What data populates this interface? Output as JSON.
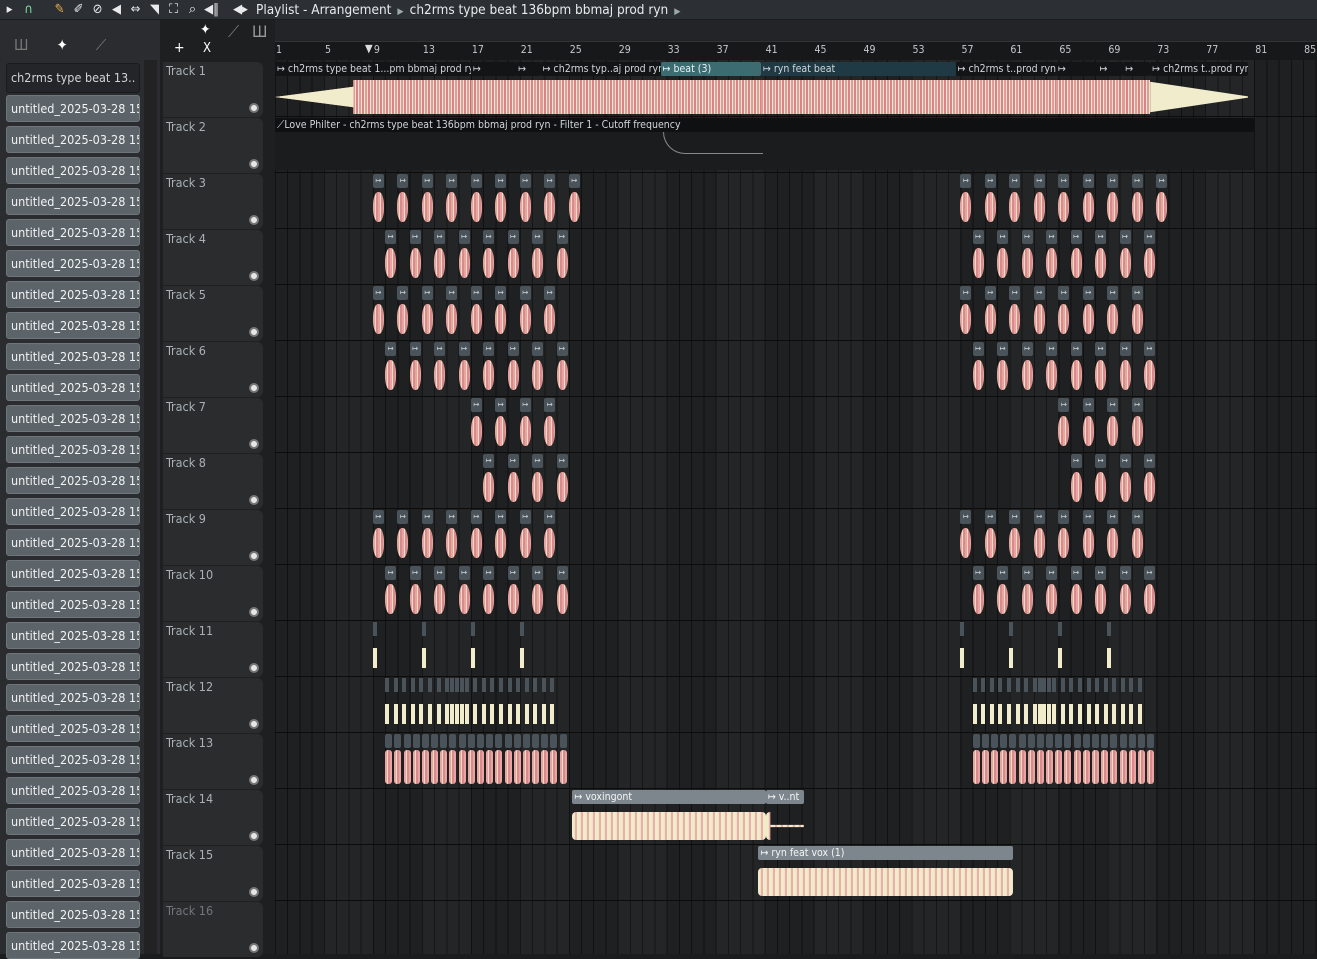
{
  "toolbar": {
    "icons": [
      "play-arrow-icon",
      "magnet-icon",
      "pencil-icon",
      "paint-brush-icon",
      "delete-icon",
      "mute-icon",
      "slip-icon",
      "slice-icon",
      "select-icon",
      "zoom-icon",
      "playback-icon"
    ],
    "title_prefix": "Playlist - Arrangement",
    "project": "ch2rms type beat 136bpm bbmaj prod ryn"
  },
  "left_panel": {
    "header_item": "ch2rms type beat 13..",
    "items": [
      "untitled_2025-03-28 15-..",
      "untitled_2025-03-28 15-..",
      "untitled_2025-03-28 15-..",
      "untitled_2025-03-28 15-..",
      "untitled_2025-03-28 15-..",
      "untitled_2025-03-28 15-..",
      "untitled_2025-03-28 15-..",
      "untitled_2025-03-28 15-..",
      "untitled_2025-03-28 15-..",
      "untitled_2025-03-28 15-..",
      "untitled_2025-03-28 15-..",
      "untitled_2025-03-28 15-..",
      "untitled_2025-03-28 15-..",
      "untitled_2025-03-28 15-..",
      "untitled_2025-03-28 15-..",
      "untitled_2025-03-28 15-..",
      "untitled_2025-03-28 15-..",
      "untitled_2025-03-28 15-..",
      "untitled_2025-03-28 15-..",
      "untitled_2025-03-28 15-..",
      "untitled_2025-03-28 15-..",
      "untitled_2025-03-28 15-..",
      "untitled_2025-03-28 15-..",
      "untitled_2025-03-28 15-..",
      "untitled_2025-03-28 15-..",
      "untitled_2025-03-28 15-..",
      "untitled_2025-03-28 15-..",
      "untitled_2025-03-28 15-.."
    ]
  },
  "header_controls": {
    "add": "+",
    "remove": "X"
  },
  "ruler": {
    "labels": [
      "1",
      "5",
      "9",
      "13",
      "17",
      "21",
      "25",
      "29",
      "33",
      "37",
      "41",
      "45",
      "49",
      "53",
      "57",
      "61",
      "65",
      "69",
      "73",
      "77",
      "81",
      "85"
    ]
  },
  "colors": {
    "wave_pink": "#e8a4a0",
    "wave_cream": "#f1eccc",
    "selected_clip": "#3c6c72",
    "pattern_tag": "#4b535a"
  },
  "tracks": [
    {
      "name": "Track 1",
      "clips": [
        {
          "label": "ch2rms type beat 1...pm bbmaj prod ryn",
          "start": 1,
          "length": 16,
          "style": "dark"
        },
        {
          "label": "",
          "start": 17,
          "length": 3.7,
          "style": "dark"
        },
        {
          "label": "",
          "start": 20.7,
          "length": 2,
          "style": "dark"
        },
        {
          "label": "ch2rms typ..aj prod ryn",
          "start": 22.7,
          "length": 9.8,
          "style": "dark"
        },
        {
          "label": "beat (3)",
          "start": 32.5,
          "length": 8.2,
          "style": "sel"
        },
        {
          "label": "ryn feat beat",
          "start": 40.7,
          "length": 15.9,
          "style": "teal"
        },
        {
          "label": "ch2rms t..prod ryn",
          "start": 56.6,
          "length": 8.2,
          "style": "dark"
        },
        {
          "label": "",
          "start": 64.8,
          "length": 3.4,
          "style": "dark"
        },
        {
          "label": "",
          "start": 68.2,
          "length": 2.1,
          "style": "dark"
        },
        {
          "label": "",
          "start": 70.3,
          "length": 2.2,
          "style": "dark"
        },
        {
          "label": "ch2rms t..prod ryn",
          "start": 72.5,
          "length": 8,
          "style": "dark"
        }
      ]
    },
    {
      "name": "Track 2",
      "automation": {
        "label": "Love Philter - ch2rms type beat 136bpm bbmaj prod ryn - Filter 1 - Cutoff frequency",
        "start": 1,
        "length": 80
      }
    },
    {
      "name": "Track 3",
      "patterns": [
        9,
        11,
        13,
        15,
        17,
        19,
        21,
        23,
        25,
        57,
        59,
        61,
        63,
        65,
        67,
        69,
        71,
        73
      ]
    },
    {
      "name": "Track 4",
      "patterns": [
        10,
        12,
        14,
        16,
        18,
        20,
        22,
        24,
        58,
        60,
        62,
        64,
        66,
        68,
        70,
        72
      ]
    },
    {
      "name": "Track 5",
      "patterns": [
        9,
        11,
        13,
        15,
        17,
        19,
        21,
        23,
        57,
        59,
        61,
        63,
        65,
        67,
        69,
        71
      ]
    },
    {
      "name": "Track 6",
      "patterns": [
        10,
        12,
        14,
        16,
        18,
        20,
        22,
        24,
        58,
        60,
        62,
        64,
        66,
        68,
        70,
        72
      ]
    },
    {
      "name": "Track 7",
      "patterns": [
        17,
        19,
        21,
        23,
        65,
        67,
        69,
        71
      ]
    },
    {
      "name": "Track 8",
      "patterns": [
        18,
        20,
        22,
        24,
        66,
        68,
        70,
        72
      ]
    },
    {
      "name": "Track 9",
      "patterns": [
        9,
        11,
        13,
        15,
        17,
        19,
        21,
        23,
        57,
        59,
        61,
        63,
        65,
        67,
        69,
        71
      ]
    },
    {
      "name": "Track 10",
      "patterns": [
        10,
        12,
        14,
        16,
        18,
        20,
        22,
        24,
        58,
        60,
        62,
        64,
        66,
        68,
        70,
        72
      ]
    },
    {
      "name": "Track 11",
      "hits": [
        9,
        13,
        17,
        21,
        57,
        61,
        65,
        69
      ]
    },
    {
      "name": "Track 12",
      "hits": [
        10,
        10.7,
        11.4,
        12.1,
        12.8,
        13.5,
        14.2,
        14.9,
        15.3,
        15.7,
        16.1,
        16.5,
        17.2,
        17.9,
        18.6,
        19.3,
        20,
        20.7,
        21.4,
        22.1,
        22.8,
        23.5,
        58,
        58.7,
        59.4,
        60.1,
        60.8,
        61.5,
        62.2,
        62.9,
        63.3,
        63.7,
        64.1,
        64.5,
        65.2,
        65.9,
        66.6,
        67.3,
        68,
        68.7,
        69.4,
        70.1,
        70.8,
        71.5
      ]
    },
    {
      "name": "Track 13",
      "dense": [
        10,
        10.75,
        11.5,
        12.25,
        13,
        13.75,
        14.5,
        15.25,
        16,
        16.75,
        17.5,
        18.25,
        19,
        19.75,
        20.5,
        21.25,
        22,
        22.75,
        23.5,
        24.25,
        58,
        58.75,
        59.5,
        60.25,
        61,
        61.75,
        62.5,
        63.25,
        64,
        64.75,
        65.5,
        66.25,
        67,
        67.75,
        68.5,
        69.25,
        70,
        70.75,
        71.5,
        72.25
      ]
    },
    {
      "name": "Track 14",
      "clips": [
        {
          "label": "voxingont",
          "start": 25.3,
          "length": 15.8,
          "style": "gray"
        },
        {
          "label": "v..nt",
          "start": 41.1,
          "length": 3.1,
          "style": "gray"
        }
      ]
    },
    {
      "name": "Track 15",
      "clips": [
        {
          "label": "ryn feat vox (1)",
          "start": 40.5,
          "length": 20.8,
          "style": "gray"
        }
      ]
    },
    {
      "name": "Track 16"
    }
  ]
}
